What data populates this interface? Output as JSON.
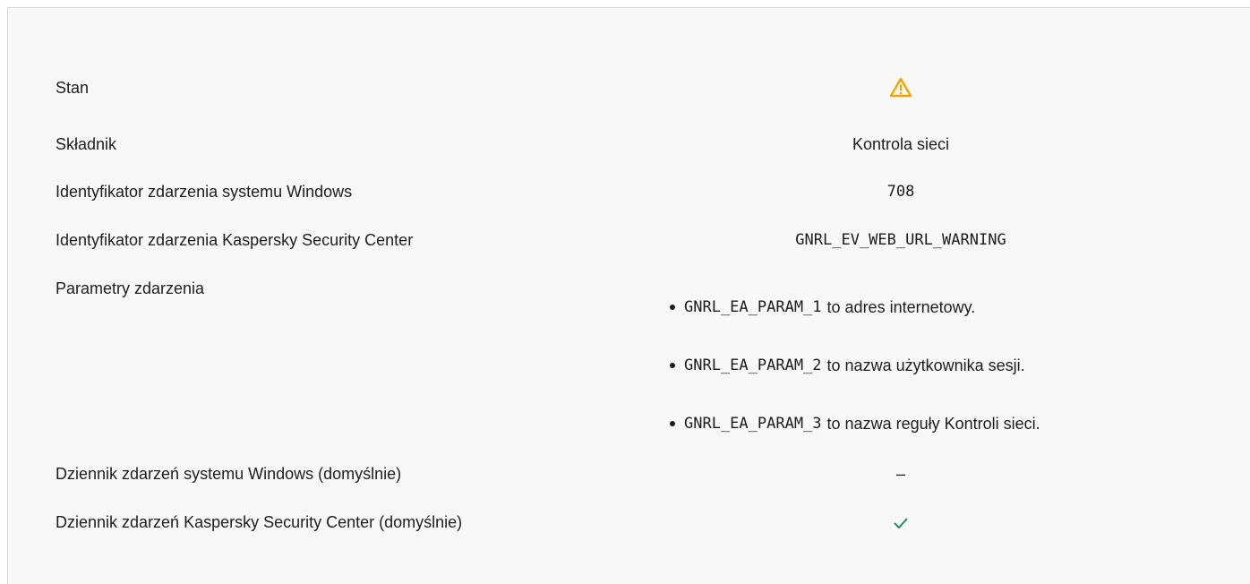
{
  "rows": [
    {
      "label": "Stan",
      "icon": "warning-triangle-icon",
      "icon_color": "#f0a500"
    },
    {
      "label": "Składnik",
      "value": "Kontrola sieci"
    },
    {
      "label": "Identyfikator zdarzenia systemu Windows",
      "value": "708"
    },
    {
      "label": "Identyfikator zdarzenia Kaspersky Security Center",
      "value": "GNRL_EV_WEB_URL_WARNING"
    },
    {
      "label": "Parametry zdarzenia",
      "params": [
        {
          "code": "GNRL_EA_PARAM_1",
          "text": "to adres internetowy."
        },
        {
          "code": "GNRL_EA_PARAM_2",
          "text": "to nazwa użytkownika sesji."
        },
        {
          "code": "GNRL_EA_PARAM_3",
          "text": "to nazwa reguły Kontroli sieci."
        }
      ]
    },
    {
      "label": "Dziennik zdarzeń systemu Windows (domyślnie)",
      "value": "–"
    },
    {
      "label": "Dziennik zdarzeń Kaspersky Security Center (domyślnie)",
      "icon": "checkmark-icon",
      "icon_color": "#1f8a6e"
    }
  ]
}
